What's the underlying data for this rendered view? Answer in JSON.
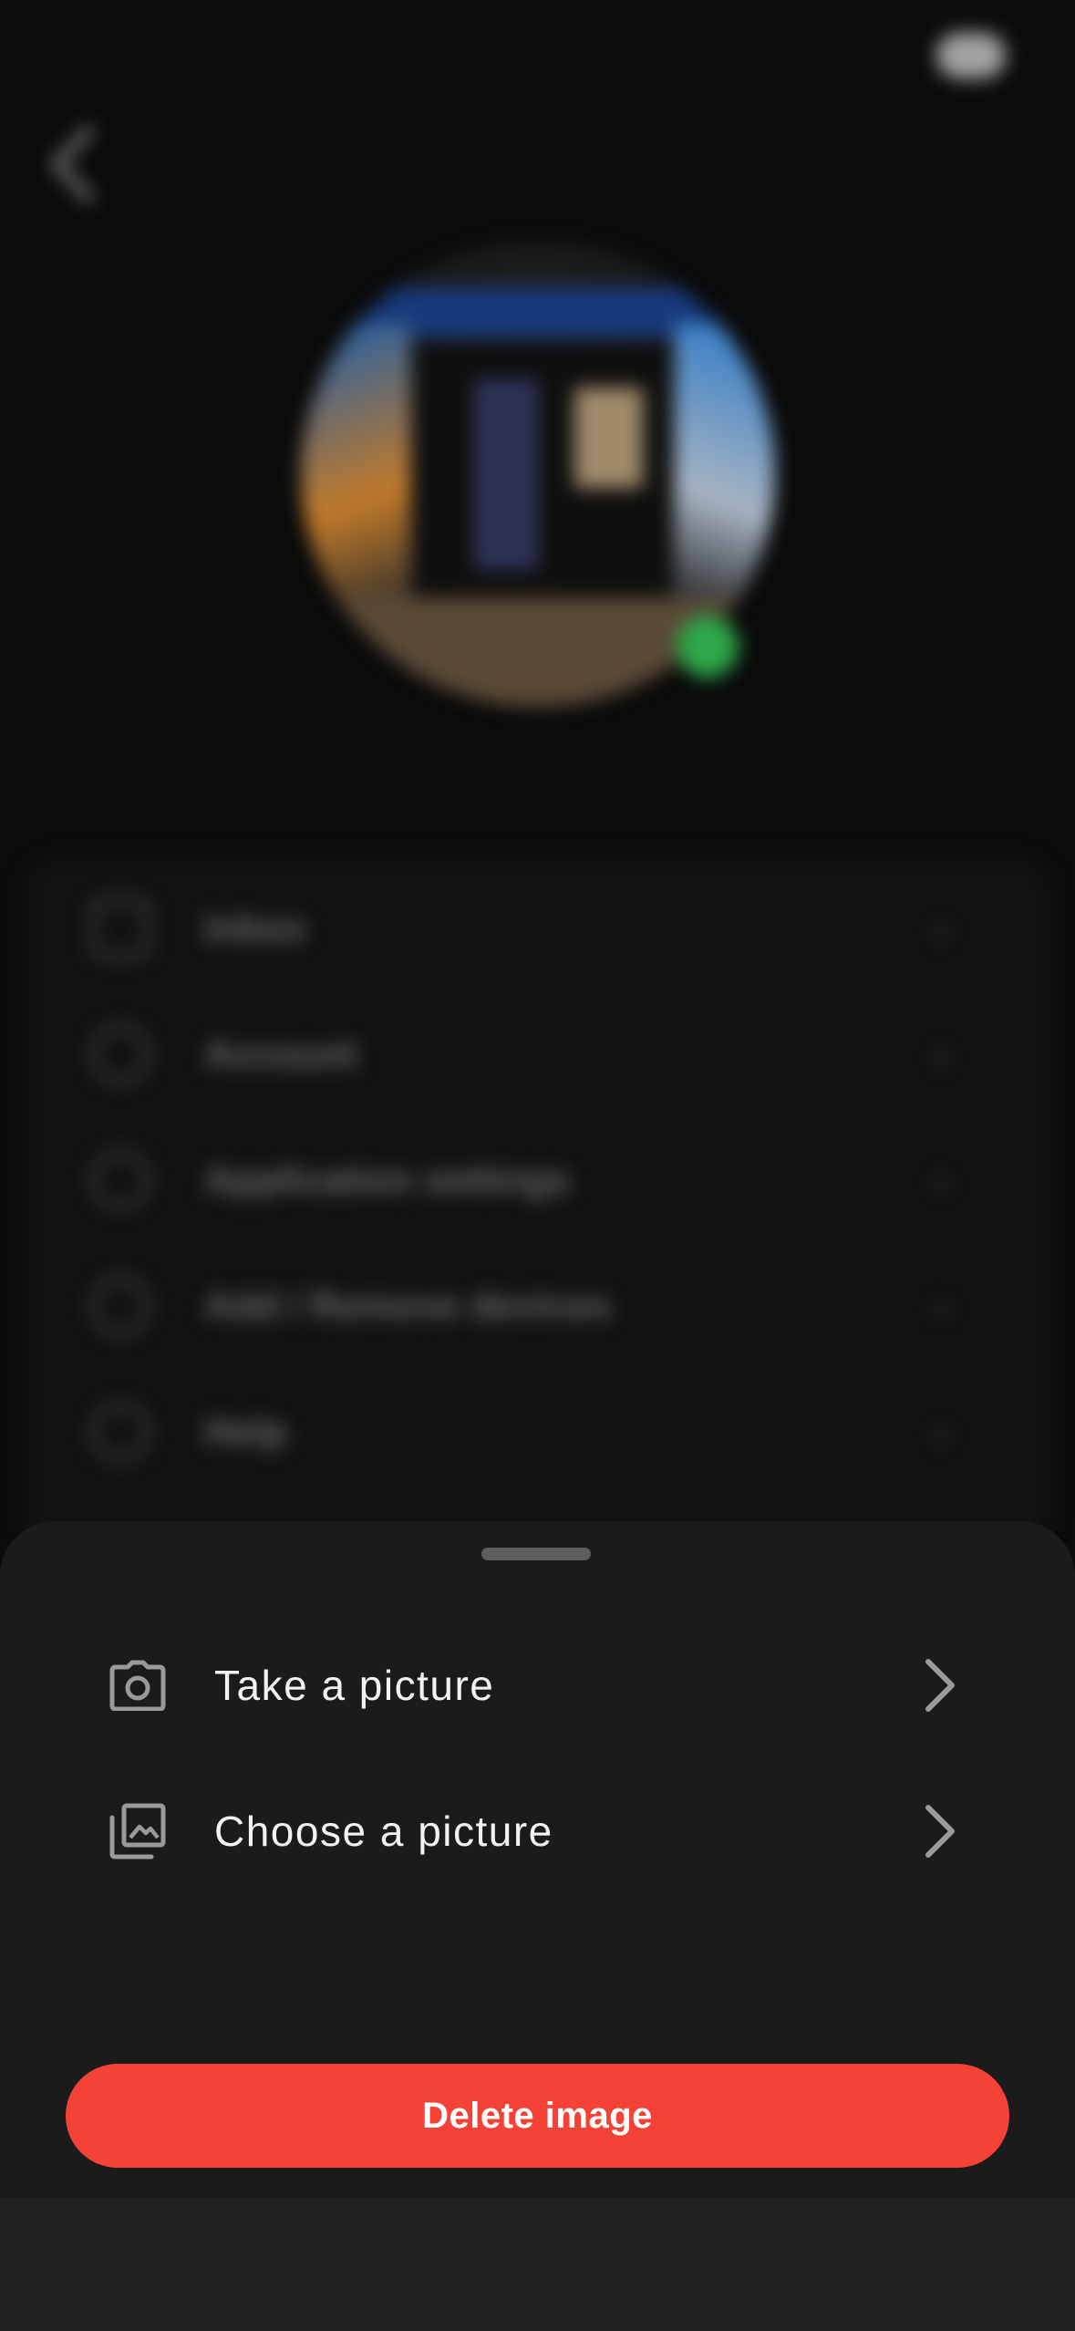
{
  "background": {
    "menu_items": [
      {
        "label": "Inbox",
        "icon": "inbox-icon"
      },
      {
        "label": "Account",
        "icon": "account-icon"
      },
      {
        "label": "Application settings",
        "icon": "settings-icon"
      },
      {
        "label": "Add / Remove devices",
        "icon": "devices-icon"
      },
      {
        "label": "Help",
        "icon": "help-icon"
      }
    ]
  },
  "sheet": {
    "options": [
      {
        "label": "Take a picture",
        "icon": "camera-icon"
      },
      {
        "label": "Choose a picture",
        "icon": "photo-library-icon"
      }
    ],
    "delete_label": "Delete image"
  },
  "colors": {
    "accent_danger": "#f44336",
    "sheet_background": "#1b1b1c",
    "online_indicator": "#2ea84a"
  }
}
